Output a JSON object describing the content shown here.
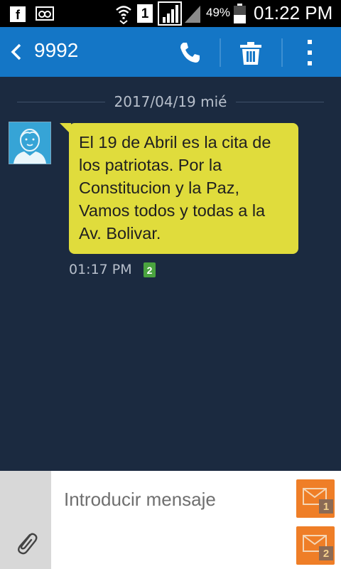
{
  "status_bar": {
    "icons": [
      "facebook-icon",
      "voicemail-icon",
      "wifi-icon",
      "sim1-icon",
      "signal-icon",
      "signal2-icon",
      "battery-icon"
    ],
    "sim_label": "1",
    "battery_percent": "49%",
    "battery_level": 0.49,
    "time": "01:22 PM"
  },
  "action_bar": {
    "contact": "9992",
    "icons": [
      "back-icon",
      "call-icon",
      "trash-icon",
      "more-icon"
    ]
  },
  "conversation": {
    "date": "2017/04/19 mié",
    "message": {
      "text": "El 19 de Abril es la cita de los patriotas. Por la Constitucion y la Paz, Vamos todos y todas a la Av. Bolivar.",
      "time": "01:17 PM",
      "sim_badge": "2"
    }
  },
  "composer": {
    "placeholder": "Introducir mensaje",
    "send1_label": "1",
    "send2_label": "2"
  },
  "colors": {
    "action_bar": "#1476c6",
    "background": "#1b2a40",
    "bubble": "#e0dc3c",
    "send_button": "#ef7e27",
    "sim2_badge": "#4aa33f"
  }
}
